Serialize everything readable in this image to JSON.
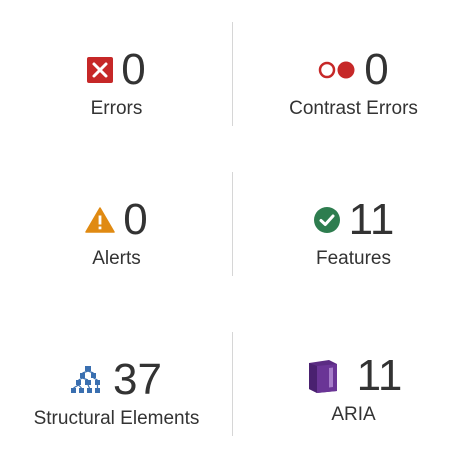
{
  "summary": {
    "errors": {
      "count": "0",
      "label": "Errors",
      "icon": "error-x-icon",
      "color": "#c62828"
    },
    "contrast_errors": {
      "count": "0",
      "label": "Contrast Errors",
      "icon": "contrast-circles-icon",
      "color": "#c62828"
    },
    "alerts": {
      "count": "0",
      "label": "Alerts",
      "icon": "warning-triangle-icon",
      "color": "#e08a12"
    },
    "features": {
      "count": "11",
      "label": "Features",
      "icon": "check-circle-icon",
      "color": "#2e7d4f"
    },
    "structural": {
      "count": "37",
      "label": "Structural Elements",
      "icon": "hierarchy-icon",
      "color": "#3a6fb0"
    },
    "aria": {
      "count": "11",
      "label": "ARIA",
      "icon": "aria-cube-icon",
      "color": "#5b2c83"
    }
  }
}
